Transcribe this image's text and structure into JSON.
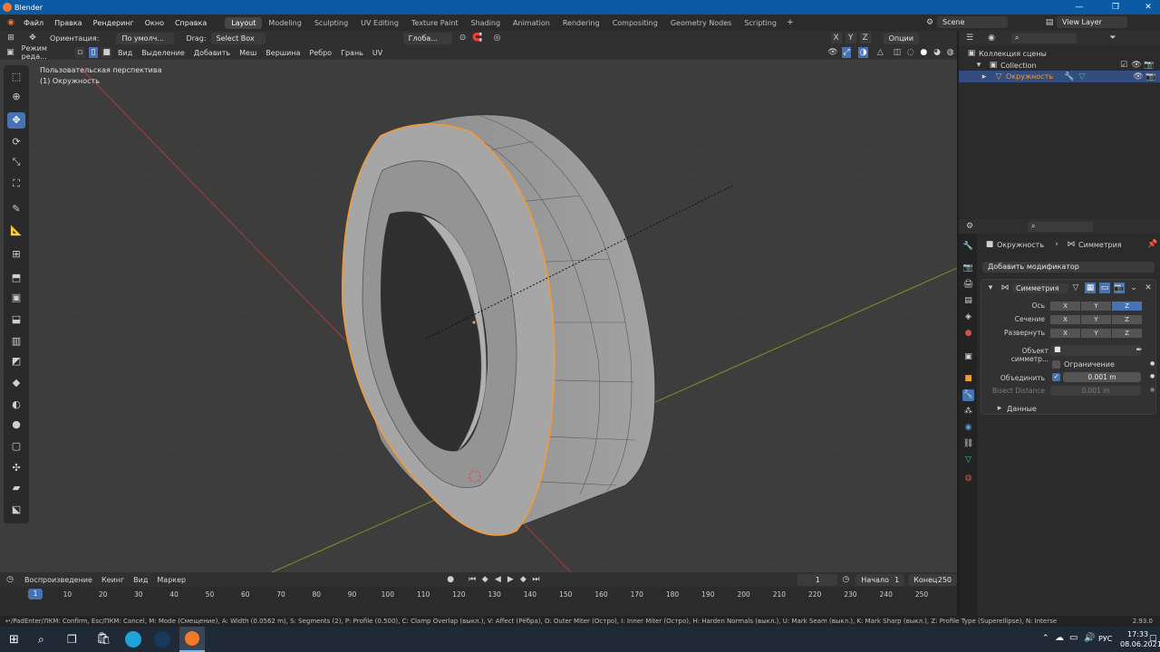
{
  "window": {
    "title": "Blender"
  },
  "menus": [
    "Файл",
    "Правка",
    "Рендеринг",
    "Окно",
    "Справка"
  ],
  "workspaces": [
    "Layout",
    "Modeling",
    "Sculpting",
    "UV Editing",
    "Texture Paint",
    "Shading",
    "Animation",
    "Rendering",
    "Compositing",
    "Geometry Nodes",
    "Scripting"
  ],
  "active_workspace": "Layout",
  "scene": {
    "name": "Scene",
    "view_layer": "View Layer"
  },
  "tool_header": {
    "orientation_label": "Ориентация:",
    "orientation_value": "По умолч...",
    "drag_label": "Drag:",
    "drag_value": "Select Box",
    "transform_value": "Глоба...",
    "options_label": "Опции",
    "axes": [
      "X",
      "Y",
      "Z"
    ]
  },
  "view_header": {
    "mode": "Режим реда...",
    "menus": [
      "Вид",
      "Выделение",
      "Добавить",
      "Меш",
      "Вершина",
      "Ребро",
      "Грань",
      "UV"
    ]
  },
  "viewport": {
    "perspective_label": "Пользовательская перспектива",
    "object_label": "(1) Окружность"
  },
  "outliner": {
    "scene_collection": "Коллекция сцены",
    "collection": "Collection",
    "object": "Окружность"
  },
  "properties": {
    "object_name": "Окружность",
    "modifier_breadcrumb": "Симметрия",
    "add_modifier": "Добавить модификатор",
    "modifier_name": "Симметрия",
    "axis_label": "Ось",
    "bisect_label": "Сечение",
    "flip_label": "Развернуть",
    "axes": [
      "X",
      "Y",
      "Z"
    ],
    "mirror_object_label": "Объект симметр...",
    "clipping_label": "Ограничение",
    "merge_label": "Объединить",
    "merge_value": "0.001 m",
    "bisect_distance_label": "Bisect Distance",
    "bisect_distance_value": "0.001 m",
    "data_label": "Данные"
  },
  "timeline": {
    "playback": "Воспроизведение",
    "keying": "Кеинг",
    "view": "Вид",
    "marker": "Маркер",
    "current_frame": "1",
    "start_label": "Начало",
    "start_value": "1",
    "end_label": "Конец",
    "end_value": "250",
    "ticks": [
      "1",
      "10",
      "20",
      "30",
      "40",
      "50",
      "60",
      "70",
      "80",
      "90",
      "100",
      "110",
      "120",
      "130",
      "140",
      "150",
      "160",
      "170",
      "180",
      "190",
      "200",
      "210",
      "220",
      "230",
      "240",
      "250"
    ]
  },
  "status": {
    "text": "↵/PadEnter/ЛКМ: Confirm, Esc/ПКМ: Cancel, M: Mode (Смещение), A: Width (0.0562 m), S: Segments (2), P: Profile (0.500), C: Clamp Overlap (выкл.), V: Affect (Рёбра), O: Outer Miter (Остро), I: Inner Miter (Остро), H: Harden Normals (выкл.), U: Mark Seam (выкл.), K: Mark Sharp (выкл.), Z: Profile Type (Superellipse), N: Intersection (Заполнить",
    "version": "2.93.0"
  },
  "taskbar": {
    "time": "17:33",
    "date": "08.06.2021",
    "lang": "РУС"
  },
  "colors": {
    "accent": "#4772b3",
    "selection": "#f29a38",
    "titlebar": "#0b5aa3"
  }
}
